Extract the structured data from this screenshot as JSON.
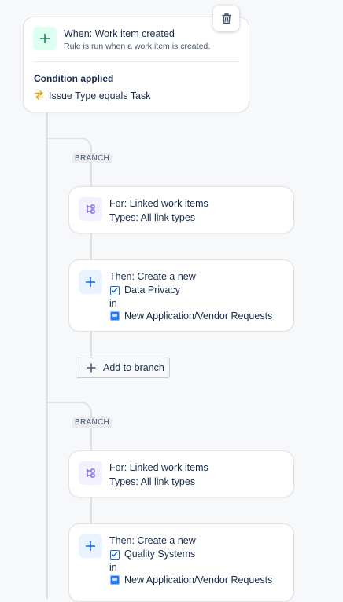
{
  "trigger": {
    "title": "When: Work item created",
    "subtitle": "Rule is run when a work item is created.",
    "condition_heading": "Condition applied",
    "condition_text": "Issue Type equals Task"
  },
  "branches": [
    {
      "tag": "BRANCH",
      "for_title": "For: Linked work items",
      "for_subtitle": "Types: All link types",
      "action_title": "Then: Create a new",
      "work_type": "Data Privacy",
      "in_label": "in",
      "project": "New Application/Vendor Requests",
      "add_label": "Add to branch"
    },
    {
      "tag": "BRANCH",
      "for_title": "For: Linked work items",
      "for_subtitle": "Types: All link types",
      "action_title": "Then: Create a new",
      "work_type": "Quality Systems",
      "in_label": "in",
      "project": "New Application/Vendor Requests"
    }
  ],
  "icons": {
    "trigger": "plus-icon",
    "condition": "swap-arrows-icon",
    "branch_for": "branch-icon",
    "action": "plus-icon",
    "work_type": "checkbox-icon",
    "project": "project-icon",
    "delete": "trash-icon"
  },
  "colors": {
    "trigger_icon_bg": "#dcfff1",
    "trigger_icon": "#1f845a",
    "branch_icon_bg": "#f3f0ff",
    "branch_icon": "#8270db",
    "action_icon_bg": "#e9f2ff",
    "action_icon": "#0c66e4",
    "condition_icon": "#e2b203"
  }
}
